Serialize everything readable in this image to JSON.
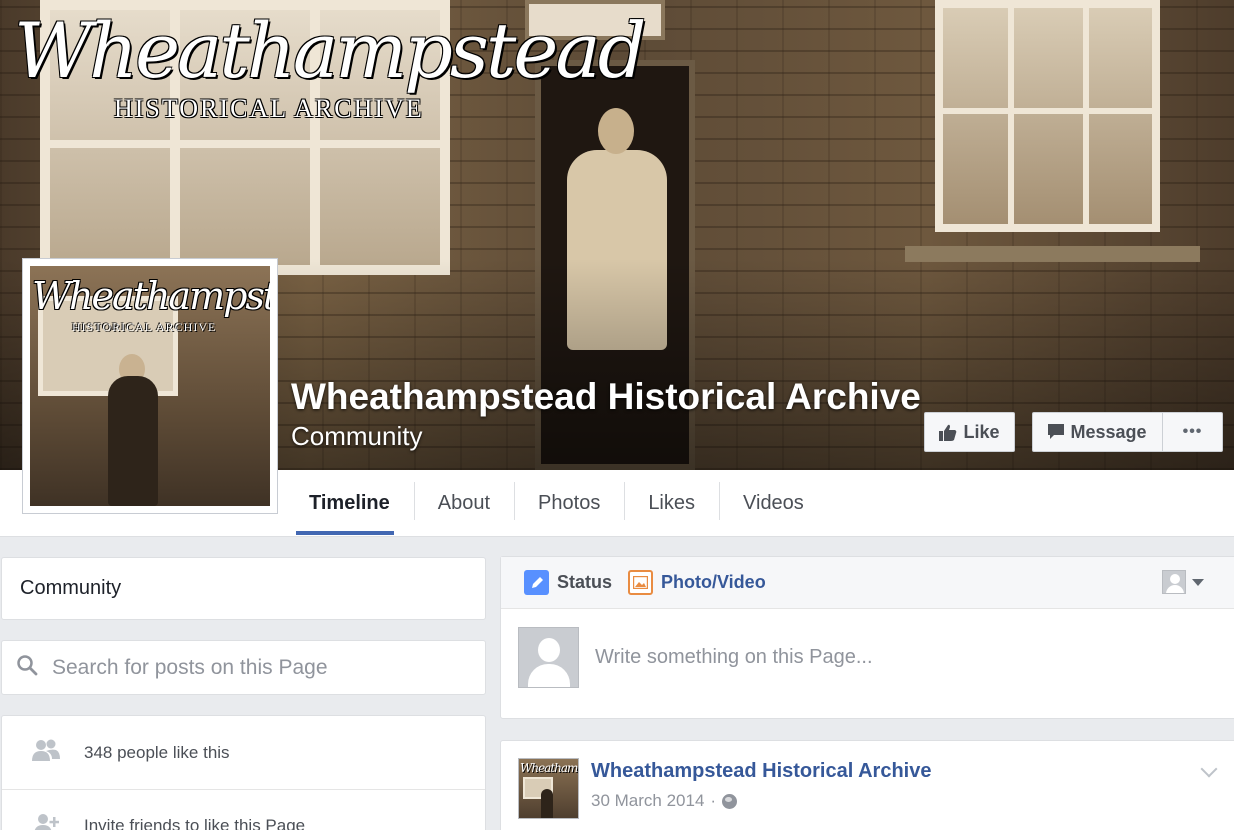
{
  "cover": {
    "logo_script": "Wheathampstead",
    "logo_caps": "HISTORICAL ARCHIVE",
    "title": "Wheathampstead Historical Archive",
    "category": "Community",
    "buttons": {
      "like": "Like",
      "message": "Message",
      "more": "•••"
    }
  },
  "avatar": {
    "logo_script": "Wheathampstead",
    "logo_caps": "HISTORICAL ARCHIVE"
  },
  "nav": {
    "tabs": [
      {
        "label": "Timeline",
        "active": true
      },
      {
        "label": "About"
      },
      {
        "label": "Photos"
      },
      {
        "label": "Likes"
      },
      {
        "label": "Videos"
      }
    ],
    "accent": "#4267b2"
  },
  "sidebar": {
    "category": "Community",
    "search_placeholder": "Search for posts on this Page",
    "stats": [
      {
        "icon": "people-icon",
        "label": "348 people like this"
      },
      {
        "icon": "add-friend-icon",
        "label": "Invite friends to like this Page"
      }
    ]
  },
  "composer": {
    "tabs": {
      "status": "Status",
      "photo_video": "Photo/Video"
    },
    "placeholder": "Write something on this Page..."
  },
  "post": {
    "author": "Wheathampstead Historical Archive",
    "date": "30 March 2014",
    "separator": "·",
    "privacy_icon": "globe-icon"
  }
}
